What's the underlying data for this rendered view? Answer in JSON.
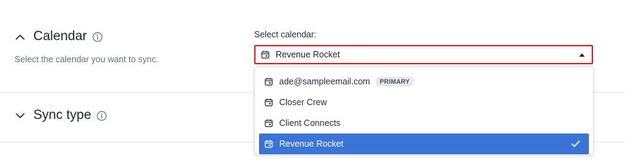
{
  "calendar_section": {
    "title": "Calendar",
    "description": "Select the calendar you want to sync.",
    "select_label": "Select calendar:",
    "selected_value": "Revenue Rocket",
    "options": [
      {
        "label": "ade@sampleemail.com",
        "badge": "PRIMARY"
      },
      {
        "label": "Closer Crew"
      },
      {
        "label": "Client Connects"
      },
      {
        "label": "Revenue Rocket",
        "selected": true
      }
    ],
    "icons": {
      "collapse": "chevron-up-icon",
      "info": "info-icon",
      "calendar": "calendar-icon",
      "caret": "caret-up-icon",
      "check": "checkmark-icon"
    }
  },
  "sync_type_section": {
    "title": "Sync type",
    "icons": {
      "expand": "chevron-down-icon",
      "info": "info-icon"
    }
  },
  "colors": {
    "selected_bg": "#3a74d6",
    "focus_border": "#d62828",
    "badge_bg": "#e7e9ec"
  }
}
